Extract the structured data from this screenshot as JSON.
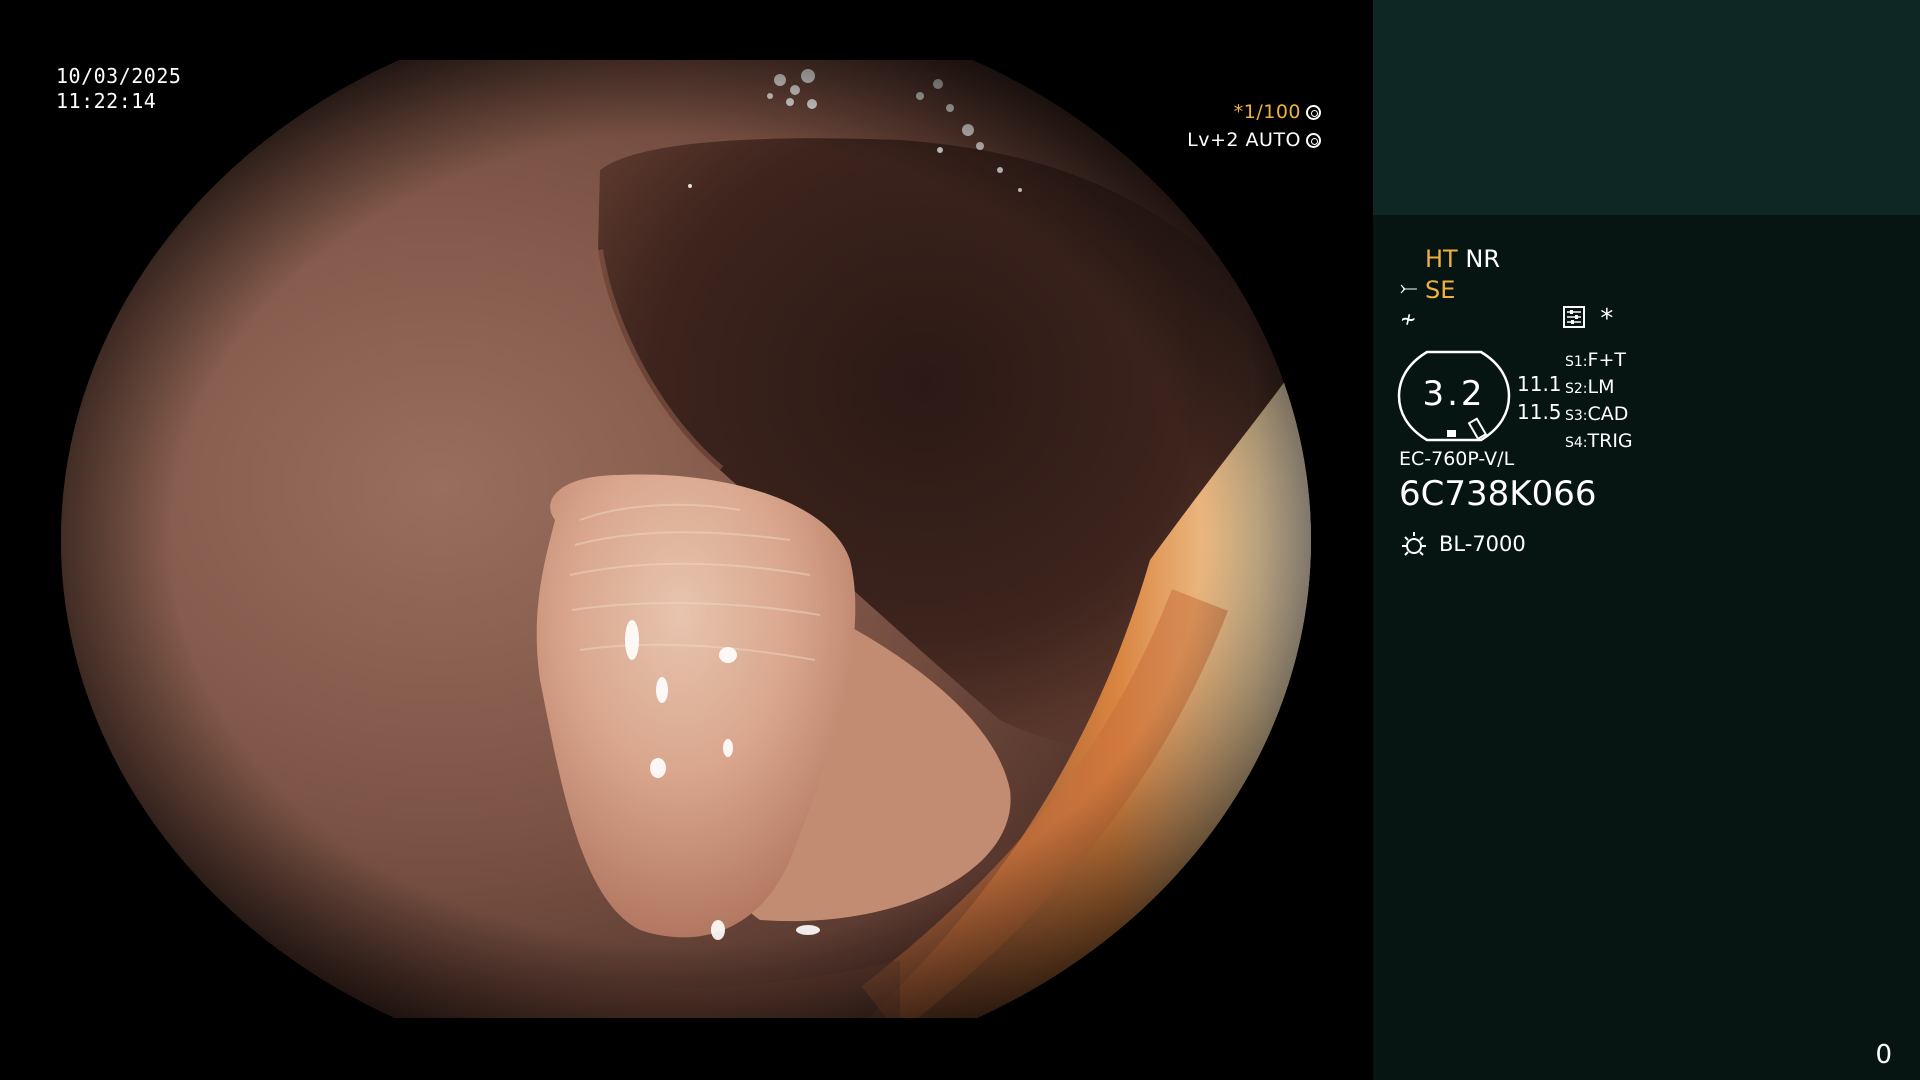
{
  "osd": {
    "date": "10/03/2025",
    "time": "11:22:14",
    "shutter_speed": "*1/100",
    "shutter_icon": "aperture-icon",
    "brightness_mode": "Lv+2 AUTO",
    "brightness_icon": "iris-icon"
  },
  "panel": {
    "mode_ht": "HT",
    "mode_nr": "NR",
    "mode_se": "SE",
    "se_icon": "structure-enhance-icon",
    "contrast_icon": "contrast-icon",
    "settings_icon": "settings-icon",
    "star_symbol": "*",
    "gauge_value": "3.2",
    "gauge_side_top": "11.1",
    "gauge_side_bottom": "11.5",
    "functions": [
      {
        "key": "S1:",
        "value": "F+T"
      },
      {
        "key": "S2:",
        "value": "LM"
      },
      {
        "key": "S3:",
        "value": "CAD"
      },
      {
        "key": "S4:",
        "value": "TRIG"
      }
    ],
    "scope_model": "EC-760P-V/L",
    "scope_serial": "6C738K066",
    "lamp_icon": "light-source-icon",
    "light_source": "BL-7000",
    "counter": "0"
  },
  "colors": {
    "panel_bg": "#061512",
    "panel_top_bg": "#0e2624",
    "accent_yellow": "#f0b040"
  }
}
